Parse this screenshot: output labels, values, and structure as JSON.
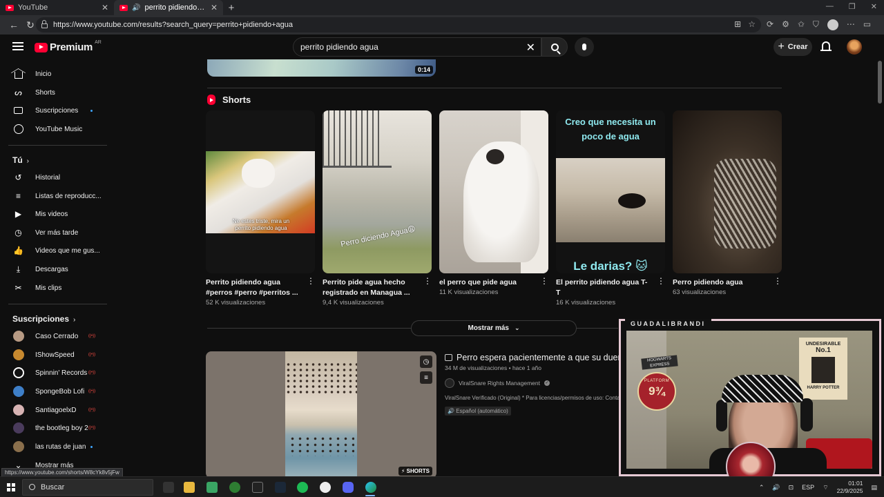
{
  "browser": {
    "tabs": [
      {
        "title": "YouTube",
        "active": false
      },
      {
        "title": "perrito pidiendo agua - YouTube",
        "active": true
      }
    ],
    "url": "https://www.youtube.com/results?search_query=perrito+pidiendo+agua"
  },
  "masthead": {
    "logo_text": "Premium",
    "country_code": "AR",
    "search_value": "perrito pidiendo agua",
    "create_label": "Crear"
  },
  "sidebar": {
    "main": [
      {
        "label": "Inicio",
        "icon": "home-icon"
      },
      {
        "label": "Shorts",
        "icon": "shorts-icon"
      },
      {
        "label": "Suscripciones",
        "icon": "subscriptions-icon"
      },
      {
        "label": "YouTube Music",
        "icon": "youtube-music-icon"
      }
    ],
    "you_heading": "Tú",
    "you": [
      {
        "label": "Historial",
        "icon": "history-icon"
      },
      {
        "label": "Listas de reproducc...",
        "icon": "playlists-icon"
      },
      {
        "label": "Mis videos",
        "icon": "my-videos-icon"
      },
      {
        "label": "Ver más tarde",
        "icon": "watch-later-icon"
      },
      {
        "label": "Videos que me gus...",
        "icon": "liked-icon"
      },
      {
        "label": "Descargas",
        "icon": "downloads-icon"
      },
      {
        "label": "Mis clips",
        "icon": "clips-icon"
      }
    ],
    "subs_heading": "Suscripciones",
    "subscriptions": [
      {
        "label": "Caso Cerrado",
        "live": true
      },
      {
        "label": "IShowSpeed",
        "live": true
      },
      {
        "label": "Spinnin' Records",
        "live": true
      },
      {
        "label": "SpongeBob Lofi",
        "live": true
      },
      {
        "label": "SantiagoelxD",
        "live": true
      },
      {
        "label": "the bootleg boy 2",
        "live": true
      },
      {
        "label": "las rutas de juan",
        "live": false
      }
    ],
    "show_more": "Mostrar más"
  },
  "results": {
    "top_video_duration": "0:14",
    "shorts_heading": "Shorts",
    "shorts": [
      {
        "title": "Perrito pidiendo agua #perros #perro #perritos ...",
        "views": "52 K visualizaciones",
        "overlay": "Ne estes triste, mira un perrito pidiendo agua"
      },
      {
        "title": "Perrito pide agua hecho registrado en Managua ...",
        "views": "9,4 K visualizaciones",
        "overlay": "Perro diciendo Agua😩"
      },
      {
        "title": "el perro que pide agua",
        "views": "11 K visualizaciones",
        "overlay": ""
      },
      {
        "title": "El perrito pidiendo agua T-T",
        "views": "16 K visualizaciones",
        "overlay_top": "Creo que necesita un poco de agua",
        "overlay_bottom": "Le darias? 🐱"
      },
      {
        "title": "Perro pidiendo agua",
        "views": "63 visualizaciones",
        "overlay": ""
      }
    ],
    "show_more": "Mostrar más",
    "video": {
      "title": "Perro espera pacientemente a que su dueño s",
      "meta": "34 M de visualizaciones • hace 1 año",
      "channel": "ViralSnare Rights Management",
      "description": "ViralSnare Verificado (Original) * Para licencias/permisos de uso: Contac",
      "badge": "Español (automático)",
      "shorts_badge": "SHORTS"
    }
  },
  "status_url": "https://www.youtube.com/shorts/W8cYk8v5jFw",
  "webcam": {
    "label": "GUADALIBRANDI",
    "poster_top": "UNDESIRABLE",
    "poster_no": "No.1",
    "poster_name": "HARRY POTTER",
    "express": "HOGWARTS EXPRESS",
    "platform_text": "PLATFORM",
    "platform_number": "9¾"
  },
  "taskbar": {
    "search_placeholder": "Buscar",
    "language": "ESP",
    "time": "01:01",
    "date": "22/9/2025"
  }
}
